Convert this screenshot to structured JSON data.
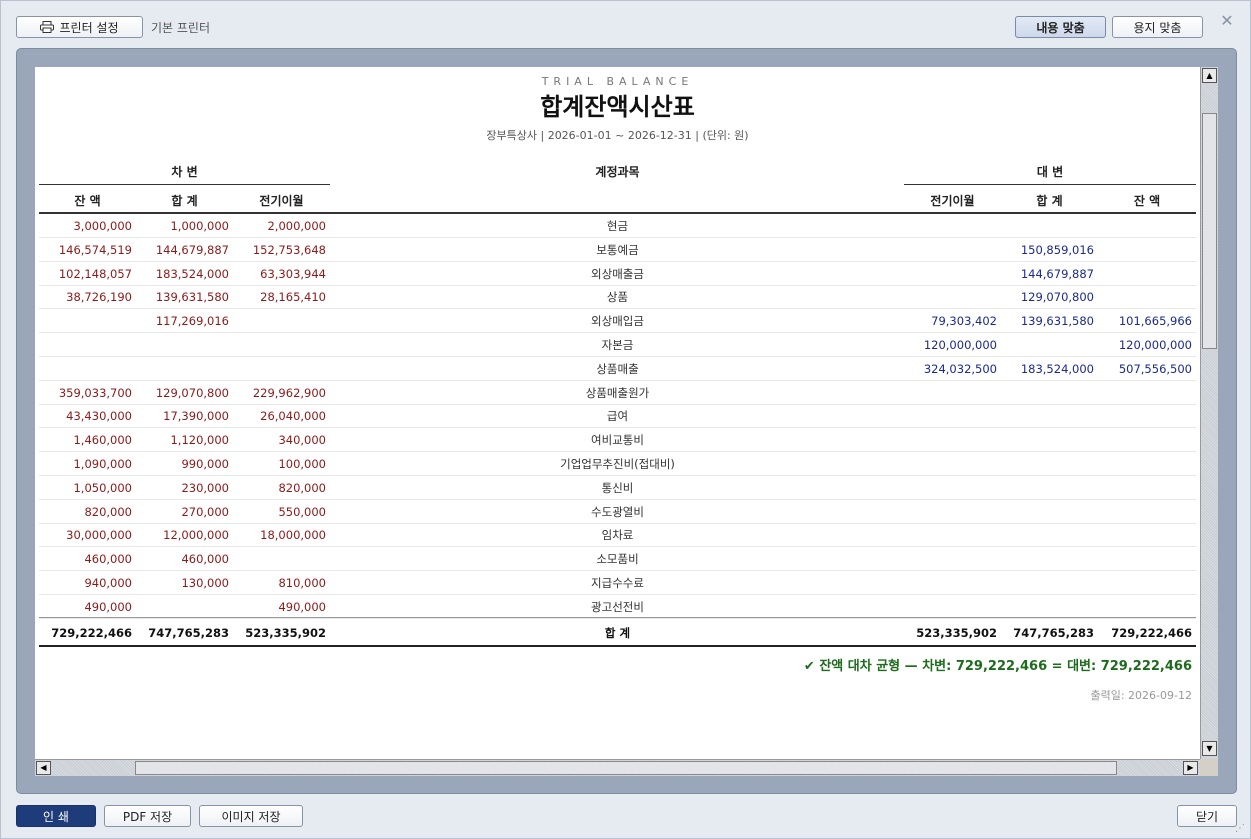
{
  "toolbar": {
    "printer_settings_label": "프린터 설정",
    "default_printer_label": "기본 프린터",
    "fit_content_label": "내용 맞춤",
    "fit_paper_label": "용지 맞춤",
    "close_symbol": "✕"
  },
  "report": {
    "subtitle": "TRIAL BALANCE",
    "title": "합계잔액시산표",
    "meta": "장부특상사 | 2026-01-01 ~ 2026-12-31 | (단위: 원)",
    "debit_group": "차 변",
    "credit_group": "대 변",
    "account_header": "계정과목",
    "columns": {
      "debit_balance": "잔 액",
      "debit_total": "합 계",
      "debit_carried": "전기이월",
      "credit_carried": "전기이월",
      "credit_total": "합 계",
      "credit_balance": "잔 액"
    },
    "rows": [
      {
        "db": "3,000,000",
        "dt": "1,000,000",
        "dc": "2,000,000",
        "acct": "현금",
        "cc": "",
        "ct": "",
        "cb": ""
      },
      {
        "db": "146,574,519",
        "dt": "144,679,887",
        "dc": "152,753,648",
        "acct": "보통예금",
        "cc": "",
        "ct": "150,859,016",
        "cb": ""
      },
      {
        "db": "102,148,057",
        "dt": "183,524,000",
        "dc": "63,303,944",
        "acct": "외상매출금",
        "cc": "",
        "ct": "144,679,887",
        "cb": ""
      },
      {
        "db": "38,726,190",
        "dt": "139,631,580",
        "dc": "28,165,410",
        "acct": "상품",
        "cc": "",
        "ct": "129,070,800",
        "cb": ""
      },
      {
        "db": "",
        "dt": "117,269,016",
        "dc": "",
        "acct": "외상매입금",
        "cc": "79,303,402",
        "ct": "139,631,580",
        "cb": "101,665,966"
      },
      {
        "db": "",
        "dt": "",
        "dc": "",
        "acct": "자본금",
        "cc": "120,000,000",
        "ct": "",
        "cb": "120,000,000"
      },
      {
        "db": "",
        "dt": "",
        "dc": "",
        "acct": "상품매출",
        "cc": "324,032,500",
        "ct": "183,524,000",
        "cb": "507,556,500"
      },
      {
        "db": "359,033,700",
        "dt": "129,070,800",
        "dc": "229,962,900",
        "acct": "상품매출원가",
        "cc": "",
        "ct": "",
        "cb": ""
      },
      {
        "db": "43,430,000",
        "dt": "17,390,000",
        "dc": "26,040,000",
        "acct": "급여",
        "cc": "",
        "ct": "",
        "cb": ""
      },
      {
        "db": "1,460,000",
        "dt": "1,120,000",
        "dc": "340,000",
        "acct": "여비교통비",
        "cc": "",
        "ct": "",
        "cb": ""
      },
      {
        "db": "1,090,000",
        "dt": "990,000",
        "dc": "100,000",
        "acct": "기업업무추진비(접대비)",
        "cc": "",
        "ct": "",
        "cb": ""
      },
      {
        "db": "1,050,000",
        "dt": "230,000",
        "dc": "820,000",
        "acct": "통신비",
        "cc": "",
        "ct": "",
        "cb": ""
      },
      {
        "db": "820,000",
        "dt": "270,000",
        "dc": "550,000",
        "acct": "수도광열비",
        "cc": "",
        "ct": "",
        "cb": ""
      },
      {
        "db": "30,000,000",
        "dt": "12,000,000",
        "dc": "18,000,000",
        "acct": "임차료",
        "cc": "",
        "ct": "",
        "cb": ""
      },
      {
        "db": "460,000",
        "dt": "460,000",
        "dc": "",
        "acct": "소모품비",
        "cc": "",
        "ct": "",
        "cb": ""
      },
      {
        "db": "940,000",
        "dt": "130,000",
        "dc": "810,000",
        "acct": "지급수수료",
        "cc": "",
        "ct": "",
        "cb": ""
      },
      {
        "db": "490,000",
        "dt": "",
        "dc": "490,000",
        "acct": "광고선전비",
        "cc": "",
        "ct": "",
        "cb": ""
      }
    ],
    "totals": {
      "db": "729,222,466",
      "dt": "747,765,283",
      "dc": "523,335,902",
      "acct": "합 계",
      "cc": "523,335,902",
      "ct": "747,765,283",
      "cb": "729,222,466"
    },
    "balance_note": "✔ 잔액 대차 균형 — 차변: 729,222,466 = 대변: 729,222,466",
    "print_date": "출력일: 2026-09-12"
  },
  "footer": {
    "print_label": "인 쇄",
    "pdf_label": "PDF 저장",
    "image_label": "이미지 저장",
    "close_label": "닫기"
  },
  "colors": {
    "debit": "#8b1a1a",
    "credit": "#1c2a8c",
    "balance_ok": "#1d6b1d",
    "primary_button": "#1f3c7a"
  }
}
